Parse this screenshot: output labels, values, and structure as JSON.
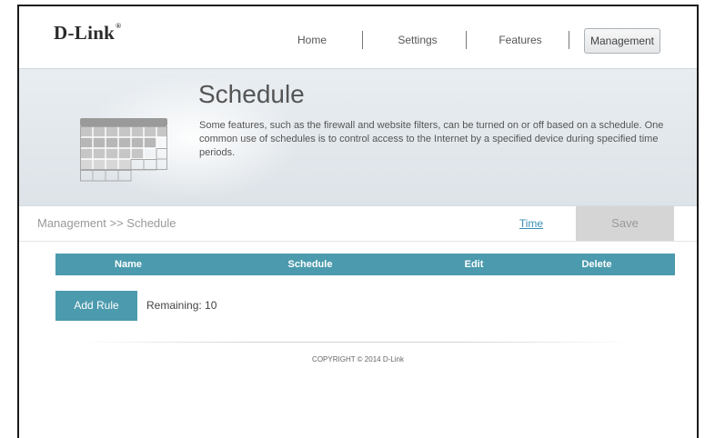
{
  "brand": {
    "logo": "D-Link",
    "mark": "®"
  },
  "nav": {
    "home": "Home",
    "settings": "Settings",
    "features": "Features",
    "management": "Management"
  },
  "banner": {
    "title": "Schedule",
    "description": "Some features, such as the firewall and website filters, can be turned on or off based on a schedule. One common use of schedules is to control access to the Internet by a specified device during specified time periods."
  },
  "breadcrumb": "Management >> Schedule",
  "actions": {
    "time": "Time",
    "save": "Save"
  },
  "table": {
    "columns": [
      "Name",
      "Schedule",
      "Edit",
      "Delete"
    ]
  },
  "add_rule": "Add Rule",
  "remaining": "Remaining: 10",
  "footer": {
    "copyright": "COPYRIGHT © 2014 D-Link"
  },
  "colors": {
    "accent": "#4b9aad",
    "link": "#3a8fb7",
    "save_bg": "#d5d5d5"
  }
}
